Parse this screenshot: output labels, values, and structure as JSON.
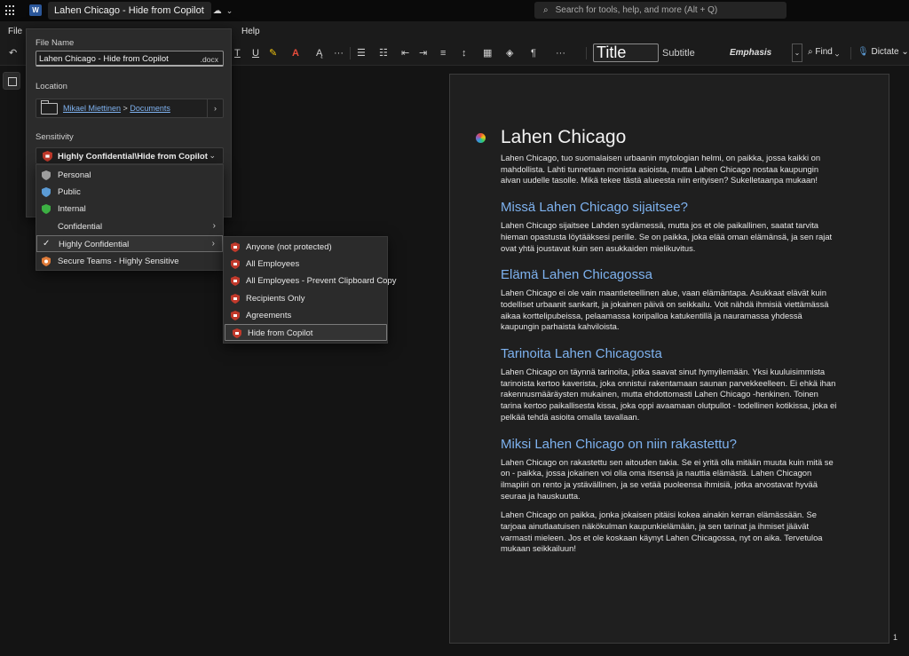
{
  "titlebar": {
    "app_icon": "word-logo-icon",
    "app_icon_letter": "W",
    "doc_title": "Lahen Chicago - Hide from Copilot",
    "search_placeholder": "Search for tools, help, and more (Alt + Q)"
  },
  "menubar": {
    "file": "File",
    "help": "Help"
  },
  "ribbon": {
    "styles": {
      "title": "Title",
      "subtitle": "Subtitle",
      "emphasis": "Emphasis"
    },
    "find": "Find",
    "dictate": "Dictate"
  },
  "file_flyout": {
    "file_name_label": "File Name",
    "file_name_value": "Lahen Chicago - Hide from Copilot",
    "file_ext": ".docx",
    "location_label": "Location",
    "location_user": "Mikael Miettinen",
    "location_sep": ">",
    "location_folder": "Documents",
    "sensitivity_label": "Sensitivity",
    "sensitivity_value": "Highly Confidential\\Hide from Copilot"
  },
  "sensitivity_menu": {
    "items": [
      {
        "label": "Personal",
        "color": "#9e9e9e"
      },
      {
        "label": "Public",
        "color": "#5b9bd5"
      },
      {
        "label": "Internal",
        "color": "#3cb043"
      },
      {
        "label": "Confidential",
        "has_submenu": true
      },
      {
        "label": "Highly Confidential",
        "checked": true,
        "has_submenu": true
      },
      {
        "label": "Secure Teams - Highly Sensitive",
        "color": "#e07b39"
      }
    ]
  },
  "sub_menu": {
    "items": [
      {
        "label": "Anyone (not protected)"
      },
      {
        "label": "All Employees"
      },
      {
        "label": "All Employees - Prevent Clipboard Copy"
      },
      {
        "label": "Recipients Only"
      },
      {
        "label": "Agreements"
      },
      {
        "label": "Hide from Copilot",
        "selected": true
      }
    ],
    "shield_color": "#c0392b"
  },
  "document": {
    "h1": "Lahen Chicago",
    "sections": [
      {
        "p": [
          "Lahen Chicago, tuo suomalaisen urbaanin mytologian helmi, on paikka, jossa kaikki on mahdollista. Lahti tunnetaan monista asioista, mutta Lahen Chicago nostaa kaupungin aivan uudelle tasolle. Mikä tekee tästä alueesta niin erityisen? Sukelletaanpa mukaan!"
        ]
      },
      {
        "h2": "Missä Lahen Chicago sijaitsee?",
        "p": [
          "Lahen Chicago sijaitsee Lahden sydämessä, mutta jos et ole paikallinen, saatat tarvita hieman opastusta löytääksesi perille. Se on paikka, joka elää oman elämänsä, ja sen rajat ovat yhtä joustavat kuin sen asukkaiden mielikuvitus."
        ]
      },
      {
        "h2": "Elämä Lahen Chicagossa",
        "p": [
          "Lahen Chicago ei ole vain maantieteellinen alue, vaan elämäntapa. Asukkaat elävät kuin todelliset urbaanit sankarit, ja jokainen päivä on seikkailu. Voit nähdä ihmisiä viettämässä aikaa korttelipubeissa, pelaamassa koripalloa katukentillä ja nauramassa yhdessä kaupungin parhaista kahviloista."
        ]
      },
      {
        "h2": "Tarinoita Lahen Chicagosta",
        "p": [
          "Lahen Chicago on täynnä tarinoita, jotka saavat sinut hymyilemään. Yksi kuuluisimmista tarinoista kertoo kaverista, joka onnistui rakentamaan saunan parvekkeelleen. Ei ehkä ihan rakennusmääräysten mukainen, mutta ehdottomasti Lahen Chicago -henkinen. Toinen tarina kertoo paikallisesta kissa, joka oppi avaamaan olutpullot - todellinen kotikissa, joka ei pelkää tehdä asioita omalla tavallaan."
        ]
      },
      {
        "h2": "Miksi Lahen Chicago on niin rakastettu?",
        "p": [
          "Lahen Chicago on rakastettu sen aitouden takia. Se ei yritä olla mitään muuta kuin mitä se on - paikka, jossa jokainen voi olla oma itsensä ja nauttia elämästä. Lahen Chicagon ilmapiiri on rento ja ystävällinen, ja se vetää puoleensa ihmisiä, jotka arvostavat hyvää seuraa ja hauskuutta.",
          "Lahen Chicago on paikka, jonka jokaisen pitäisi kokea ainakin kerran elämässään. Se tarjoaa ainutlaatuisen näkökulman kaupunkielämään, ja sen tarinat ja ihmiset jäävät varmasti mieleen. Jos et ole koskaan käynyt Lahen Chicagossa, nyt on aika. Tervetuloa mukaan seikkailuun!"
        ]
      }
    ],
    "page_number": "1"
  }
}
